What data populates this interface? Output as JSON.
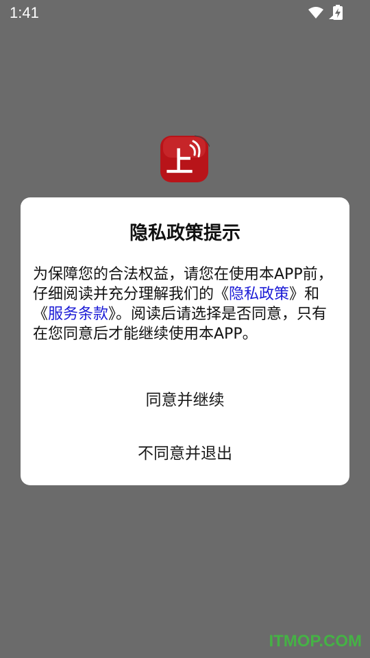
{
  "status_bar": {
    "time": "1:41",
    "icons": [
      "wifi-icon",
      "signal-icon",
      "battery-charging-icon"
    ]
  },
  "app": {
    "logo_char": "上",
    "logo_color": "#c8161d"
  },
  "dialog": {
    "title": "隐私政策提示",
    "body_intro": "为保障您的合法权益，请您在使用本APP前，仔细阅读并充分理解我们的",
    "link_open": "《",
    "privacy_link": "隐私政策",
    "link_close": "》",
    "and": "和",
    "terms_link": "服务条款",
    "body_end": "。阅读后请选择是否同意，只有在您同意后才能继续使用本APP。",
    "agree_label": "同意并继续",
    "disagree_label": "不同意并退出"
  },
  "watermark": "ITMOP.COM",
  "colors": {
    "overlay": "#6b6b6b",
    "link": "#1a1ad6",
    "dialog_bg": "#ffffff"
  }
}
